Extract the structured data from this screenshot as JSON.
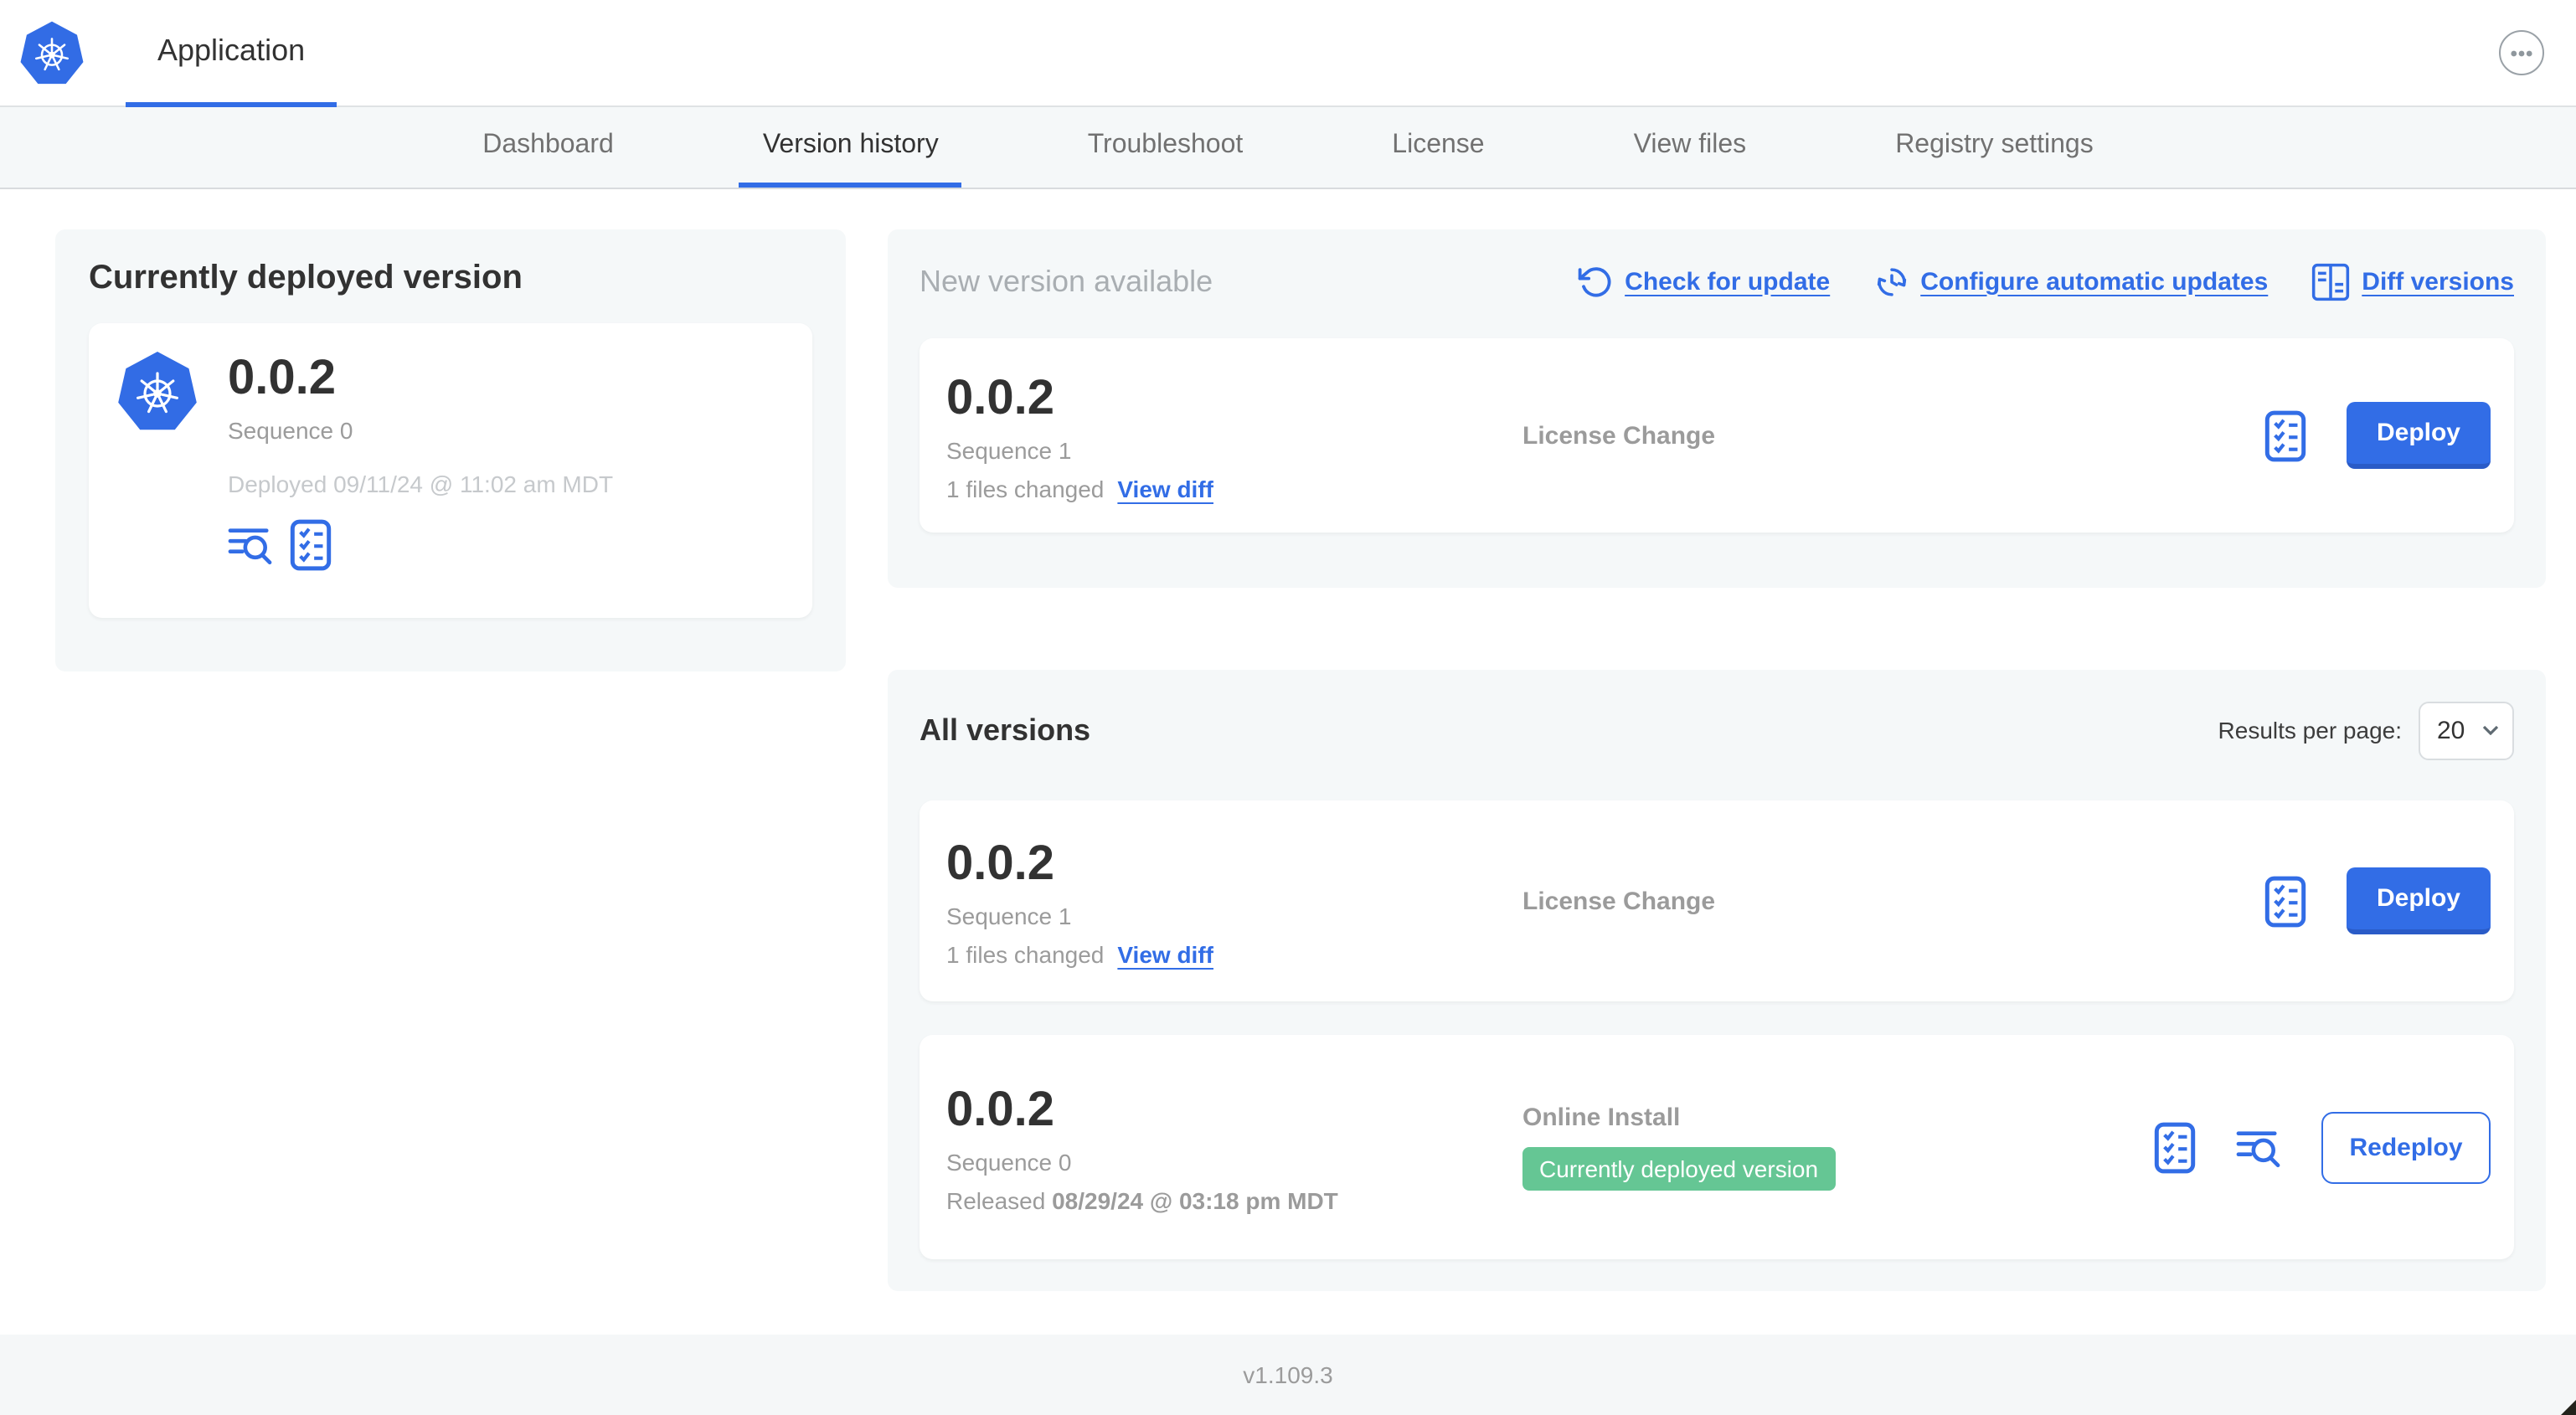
{
  "colors": {
    "accent": "#326DE6",
    "accent_dark": "#2a5bc7",
    "badge_green": "#65C694",
    "panel_bg": "#F5F8F9",
    "text_dark": "#323232",
    "text_gray": "#9B9B9B",
    "text_light_gray": "#C6C9CC"
  },
  "header": {
    "app_title": "Application"
  },
  "nav": {
    "tabs": [
      {
        "label": "Dashboard",
        "active": false
      },
      {
        "label": "Version history",
        "active": true
      },
      {
        "label": "Troubleshoot",
        "active": false
      },
      {
        "label": "License",
        "active": false
      },
      {
        "label": "View files",
        "active": false
      },
      {
        "label": "Registry settings",
        "active": false
      }
    ]
  },
  "current_version_panel": {
    "title": "Currently deployed version",
    "version": "0.0.2",
    "sequence": "Sequence 0",
    "deployed_timestamp": "Deployed 09/11/24 @ 11:02 am MDT",
    "icons": [
      "file-logs-icon",
      "preflight-checklist-icon"
    ]
  },
  "new_version_panel": {
    "title": "New version available",
    "actions": [
      {
        "label": "Check for update",
        "icon": "refresh-icon"
      },
      {
        "label": "Configure automatic updates",
        "icon": "clock-refresh-icon"
      },
      {
        "label": "Diff versions",
        "icon": "diff-icon"
      }
    ],
    "row": {
      "version": "0.0.2",
      "sequence": "Sequence 1",
      "files_changed": "1 files changed",
      "view_diff_label": "View diff",
      "source": "License Change",
      "action_label": "Deploy"
    }
  },
  "all_versions_panel": {
    "title": "All versions",
    "results_per_page_label": "Results per page:",
    "results_per_page_value": "20",
    "rows": [
      {
        "version": "0.0.2",
        "sequence": "Sequence 1",
        "files_changed": "1 files changed",
        "view_diff_label": "View diff",
        "source": "License Change",
        "action_label": "Deploy"
      },
      {
        "version": "0.0.2",
        "sequence": "Sequence 0",
        "released_prefix": "Released ",
        "released_date": "08/29/24 @ 03:18 pm MDT",
        "source": "Online Install",
        "badge": "Currently deployed version",
        "action_label": "Redeploy"
      }
    ]
  },
  "footer": {
    "app_manager_version": "v1.109.3"
  }
}
